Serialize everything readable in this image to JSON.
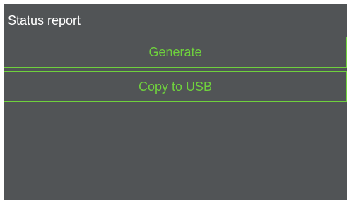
{
  "header": {
    "title": "Status report"
  },
  "actions": {
    "generate_label": "Generate",
    "copy_label": "Copy to USB"
  },
  "colors": {
    "background": "#515456",
    "accent": "#6fd13d",
    "text": "#ffffff"
  }
}
